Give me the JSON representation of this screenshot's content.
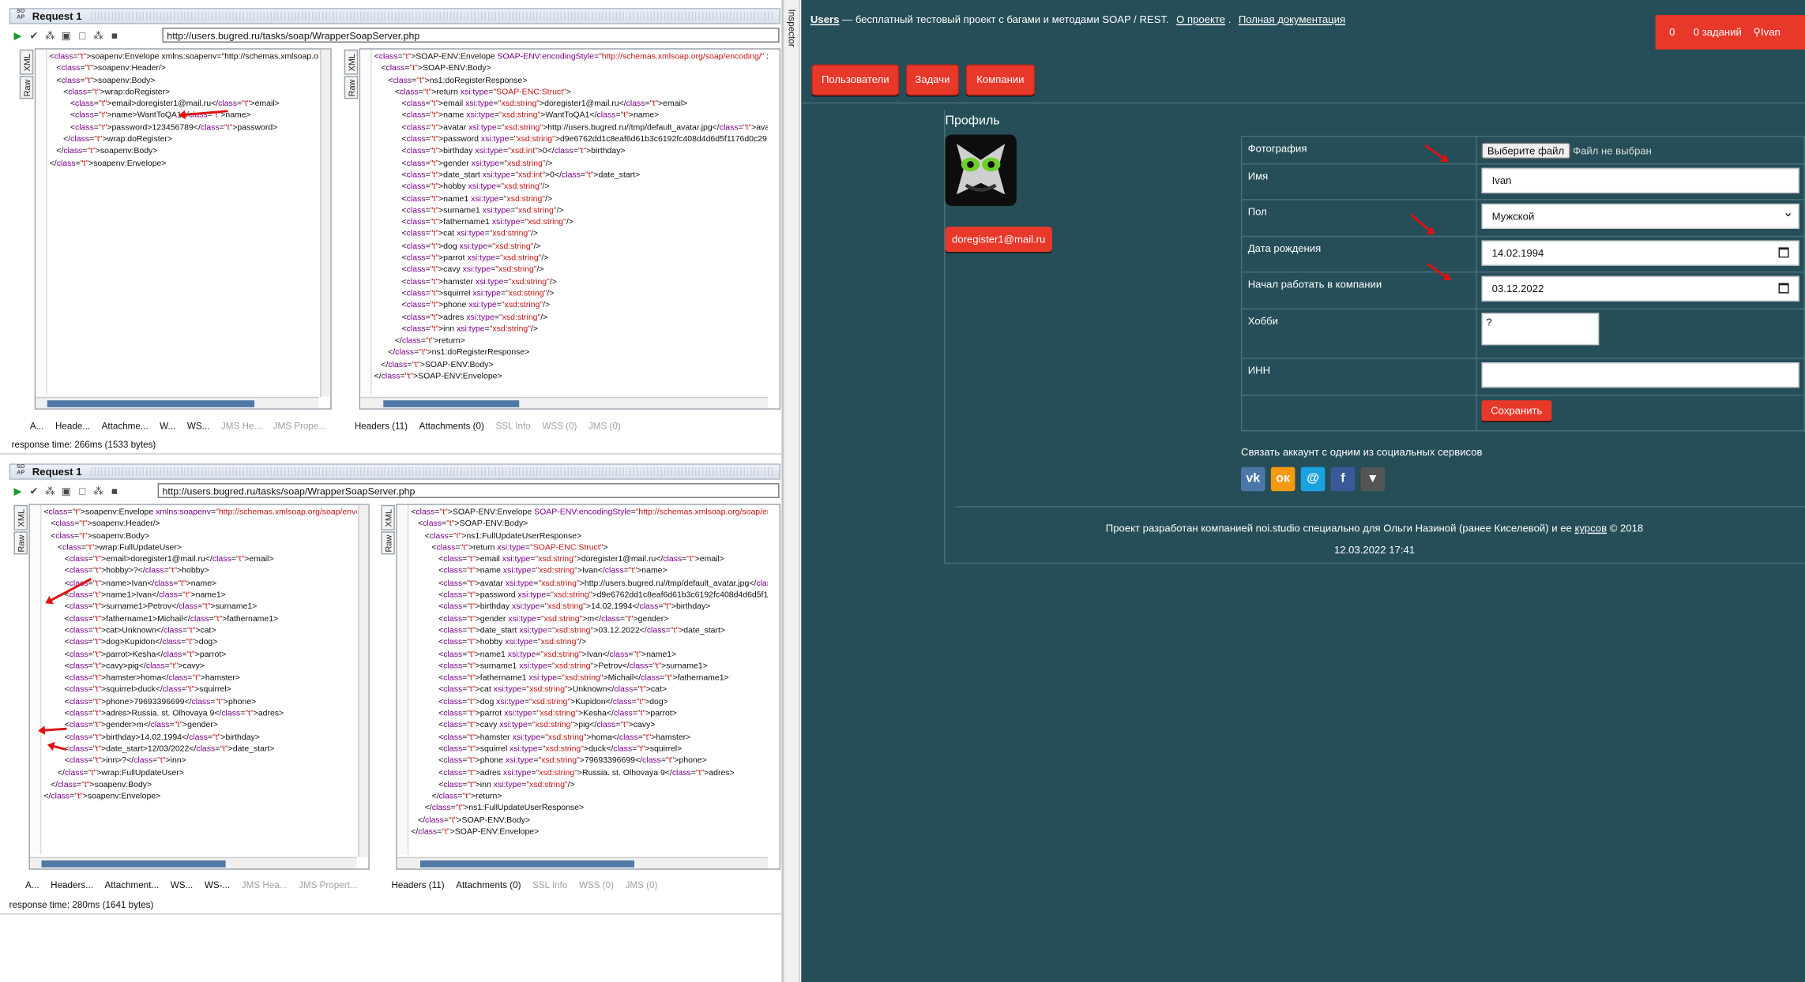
{
  "soapui": {
    "req1": {
      "title": "Request 1",
      "url": "http://users.bugred.ru/tasks/soap/WrapperSoapServer.php",
      "xml_tab": "XML",
      "raw_tab": "Raw",
      "request_lines": [
        "<soapenv:Envelope xmlns:soapenv=\"http://schemas.xmlsoap.org/soap/",
        "   <soapenv:Header/>",
        "   <soapenv:Body>",
        "      <wrap:doRegister>",
        "         <email>doregister1@mail.ru</email>",
        "         <name>WantToQA1</name>",
        "         <password>123456789</password>",
        "      </wrap:doRegister>",
        "   </soapenv:Body>",
        "</soapenv:Envelope>"
      ],
      "response_lines": [
        "<SOAP-ENV:Envelope SOAP-ENV:encodingStyle=\"http://schemas.xmlsoap.org/soap/encoding/\" xmlns:SOA",
        "   <SOAP-ENV:Body>",
        "      <ns1:doRegisterResponse>",
        "         <return xsi:type=\"SOAP-ENC:Struct\">",
        "            <email xsi:type=\"xsd:string\">doregister1@mail.ru</email>",
        "            <name xsi:type=\"xsd:string\">WantToQA1</name>",
        "            <avatar xsi:type=\"xsd:string\">http://users.bugred.ru//tmp/default_avatar.jpg</avatar>",
        "            <password xsi:type=\"xsd:string\">d9e6762dd1c8eaf6d61b3c6192fc408d4d6d5f1176d0c29169bc2",
        "            <birthday xsi:type=\"xsd:int\">0</birthday>",
        "            <gender xsi:type=\"xsd:string\"/>",
        "            <date_start xsi:type=\"xsd:int\">0</date_start>",
        "            <hobby xsi:type=\"xsd:string\"/>",
        "            <name1 xsi:type=\"xsd:string\"/>",
        "            <surname1 xsi:type=\"xsd:string\"/>",
        "            <fathername1 xsi:type=\"xsd:string\"/>",
        "            <cat xsi:type=\"xsd:string\"/>",
        "            <dog xsi:type=\"xsd:string\"/>",
        "            <parrot xsi:type=\"xsd:string\"/>",
        "            <cavy xsi:type=\"xsd:string\"/>",
        "            <hamster xsi:type=\"xsd:string\"/>",
        "            <squirrel xsi:type=\"xsd:string\"/>",
        "            <phone xsi:type=\"xsd:string\"/>",
        "            <adres xsi:type=\"xsd:string\"/>",
        "            <inn xsi:type=\"xsd:string\"/>",
        "         </return>",
        "      </ns1:doRegisterResponse>",
        "   </SOAP-ENV:Body>",
        "</SOAP-ENV:Envelope>"
      ],
      "req_tabs": [
        "A...",
        "Heade...",
        "Attachme...",
        "W...",
        "WS...",
        "JMS He...",
        "JMS Prope..."
      ],
      "resp_tabs": [
        "Headers (11)",
        "Attachments (0)",
        "SSL Info",
        "WSS (0)",
        "JMS (0)"
      ],
      "status": "response time: 266ms (1533 bytes)"
    },
    "req2": {
      "title": "Request 1",
      "url": "http://users.bugred.ru/tasks/soap/WrapperSoapServer.php",
      "xml_tab": "XML",
      "raw_tab": "Raw",
      "request_lines": [
        "<soapenv:Envelope xmlns:soapenv=\"http://schemas.xmlsoap.org/soap/envelope/\"",
        "   <soapenv:Header/>",
        "   <soapenv:Body>",
        "      <wrap:FullUpdateUser>",
        "         <email>doregister1@mail.ru</email>",
        "         <hobby>?</hobby>",
        "         <name>Ivan</name>",
        "         <name1>Ivan</name1>",
        "         <surname1>Petrov</surname1>",
        "         <fathername1>Michail</fathername1>",
        "         <cat>Unknown</cat>",
        "         <dog>Kupidon</dog>",
        "         <parrot>Kesha</parrot>",
        "         <cavy>pig</cavy>",
        "         <hamster>homa</hamster>",
        "         <squirrel>duck</squirrel>",
        "         <phone>79693396699</phone>",
        "         <adres>Russia. st. Olhovaya 9</adres>",
        "         <gender>m</gender>",
        "         <birthday>14.02.1994</birthday>",
        "         <date_start>12/03/2022</date_start>",
        "         <inn>?</inn>",
        "      </wrap:FullUpdateUser>",
        "   </soapenv:Body>",
        "</soapenv:Envelope>"
      ],
      "response_lines": [
        "<SOAP-ENV:Envelope SOAP-ENV:encodingStyle=\"http://schemas.xmlsoap.org/soap/encoding/\" x",
        "   <SOAP-ENV:Body>",
        "      <ns1:FullUpdateUserResponse>",
        "         <return xsi:type=\"SOAP-ENC:Struct\">",
        "            <email xsi:type=\"xsd:string\">doregister1@mail.ru</email>",
        "            <name xsi:type=\"xsd:string\">Ivan</name>",
        "            <avatar xsi:type=\"xsd:string\">http://users.bugred.ru//tmp/default_avatar.jpg</avatar>",
        "            <password xsi:type=\"xsd:string\">d9e6762dd1c8eaf6d61b3c6192fc408d4d6d5f1176d0c2",
        "            <birthday xsi:type=\"xsd:string\">14.02.1994</birthday>",
        "            <gender xsi:type=\"xsd:string\">m</gender>",
        "            <date_start xsi:type=\"xsd:string\">03.12.2022</date_start>",
        "            <hobby xsi:type=\"xsd:string\"/>",
        "            <name1 xsi:type=\"xsd:string\">Ivan</name1>",
        "            <surname1 xsi:type=\"xsd:string\">Petrov</surname1>",
        "            <fathername1 xsi:type=\"xsd:string\">Michail</fathername1>",
        "            <cat xsi:type=\"xsd:string\">Unknown</cat>",
        "            <dog xsi:type=\"xsd:string\">Kupidon</dog>",
        "            <parrot xsi:type=\"xsd:string\">Kesha</parrot>",
        "            <cavy xsi:type=\"xsd:string\">pig</cavy>",
        "            <hamster xsi:type=\"xsd:string\">homa</hamster>",
        "            <squirrel xsi:type=\"xsd:string\">duck</squirrel>",
        "            <phone xsi:type=\"xsd:string\">79693396699</phone>",
        "            <adres xsi:type=\"xsd:string\">Russia. st. Olhovaya 9</adres>",
        "            <inn xsi:type=\"xsd:string\"/>",
        "         </return>",
        "      </ns1:FullUpdateUserResponse>",
        "   </SOAP-ENV:Body>",
        "</SOAP-ENV:Envelope>"
      ],
      "req_tabs": [
        "A...",
        "Headers...",
        "Attachment...",
        "WS...",
        "WS-...",
        "JMS Hea...",
        "JMS Propert..."
      ],
      "resp_tabs": [
        "Headers (11)",
        "Attachments (0)",
        "SSL Info",
        "WSS (0)",
        "JMS (0)"
      ],
      "status": "response time: 280ms (1641 bytes)"
    },
    "inspector_label": "Inspector"
  },
  "web": {
    "brand": "Users",
    "tagline": " — бесплатный тестовый проект с багами и методами SOAP / REST.",
    "about_link": "О проекте",
    "docs_link": "Полная документация",
    "counter": "0",
    "tasks_label": "0 заданий",
    "user_label": "Ivan",
    "nav": [
      "Пользователи",
      "Задачи",
      "Компании"
    ],
    "profile_title": "Профиль",
    "email_button": "doregister1@mail.ru",
    "form": {
      "photo_label": "Фотография",
      "file_button": "Выберите файл",
      "file_none": "Файл не выбран",
      "name_label": "Имя",
      "name_value": "Ivan",
      "gender_label": "Пол",
      "gender_value": "Мужской",
      "birth_label": "Дата рождения",
      "birth_value": "14.02.1994",
      "start_label": "Начал работать в компании",
      "start_value": "03.12.2022",
      "hobby_label": "Хобби",
      "hobby_value": "?",
      "inn_label": "ИНН",
      "inn_value": "",
      "save_button": "Сохранить"
    },
    "social_text": "Связать аккаунт с одним из социальных сервисов",
    "social_icons": [
      "vk-icon",
      "odnoklassniki-icon",
      "mailru-icon",
      "facebook-icon",
      "more-icon"
    ],
    "footer_line1": "Проект разработан компанией noi.studio специально для Ольги Назиной (ранее Киселевой) и ее",
    "footer_link": "курсов",
    "footer_tail": "© 2018",
    "footer_date": "12.03.2022 17:41",
    "colors": {
      "accent": "#e8382a",
      "background": "#254e58"
    }
  }
}
